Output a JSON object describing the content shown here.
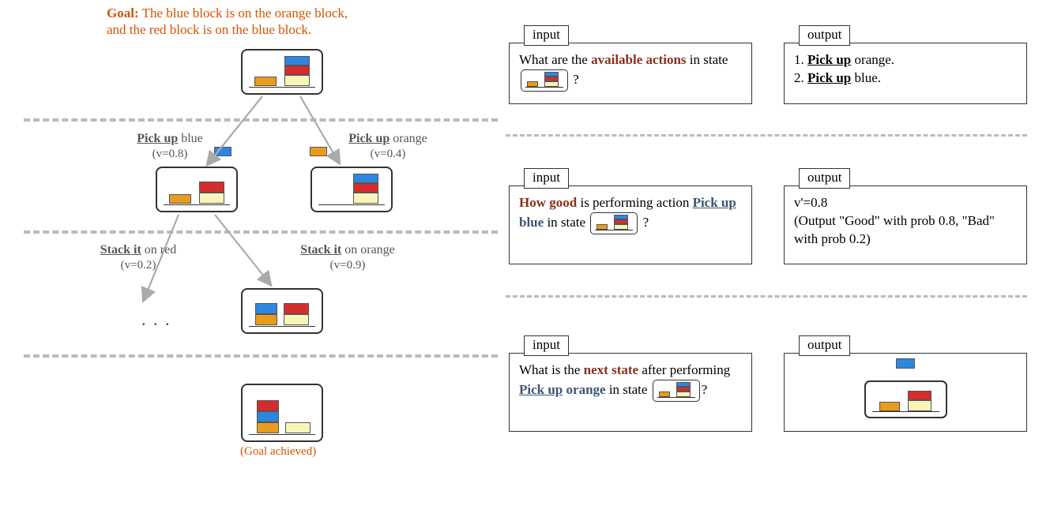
{
  "goal": {
    "label": "Goal:",
    "line1": "The blue block is on the orange block,",
    "line2": "and the red block is on the blue block."
  },
  "actions": {
    "pickup_blue": {
      "label": "Pick up",
      "obj": " blue",
      "value": "(v=0.8)"
    },
    "pickup_orange": {
      "label": "Pick up",
      "obj": " orange",
      "value": "(v=0.4)"
    },
    "stack_red": {
      "label": "Stack it",
      "obj": " on red",
      "value": "(v=0.2)"
    },
    "stack_orange": {
      "label": "Stack it",
      "obj": " on orange",
      "value": "(v=0.9)"
    }
  },
  "ellipsis": ". . .",
  "goal_achieved": "(Goal achieved)",
  "io": {
    "input_label": "input",
    "output_label": "output",
    "box1_in": {
      "pre": "What are the ",
      "brown": "available actions",
      "post": " in state ",
      "q": "?"
    },
    "box1_out": {
      "l1a": "1. ",
      "l1b": "Pick up",
      "l1c": " orange.",
      "l2a": "2. ",
      "l2b": "Pick up",
      "l2c": " blue."
    },
    "box2_in": {
      "a": "How good",
      "b": " is performing action ",
      "c": "Pick up",
      "d": " blue",
      "e": " in state ",
      "q": "?"
    },
    "box2_out": {
      "l1": "v'=0.8",
      "l2": "(Output \"Good\" with prob 0.8, \"Bad\" with prob 0.2)"
    },
    "box3_in": {
      "a": "What is the ",
      "b": "next state",
      "c": " after performing ",
      "d": "Pick up",
      "e": " orange",
      "f": " in state ",
      "q": "?"
    }
  }
}
